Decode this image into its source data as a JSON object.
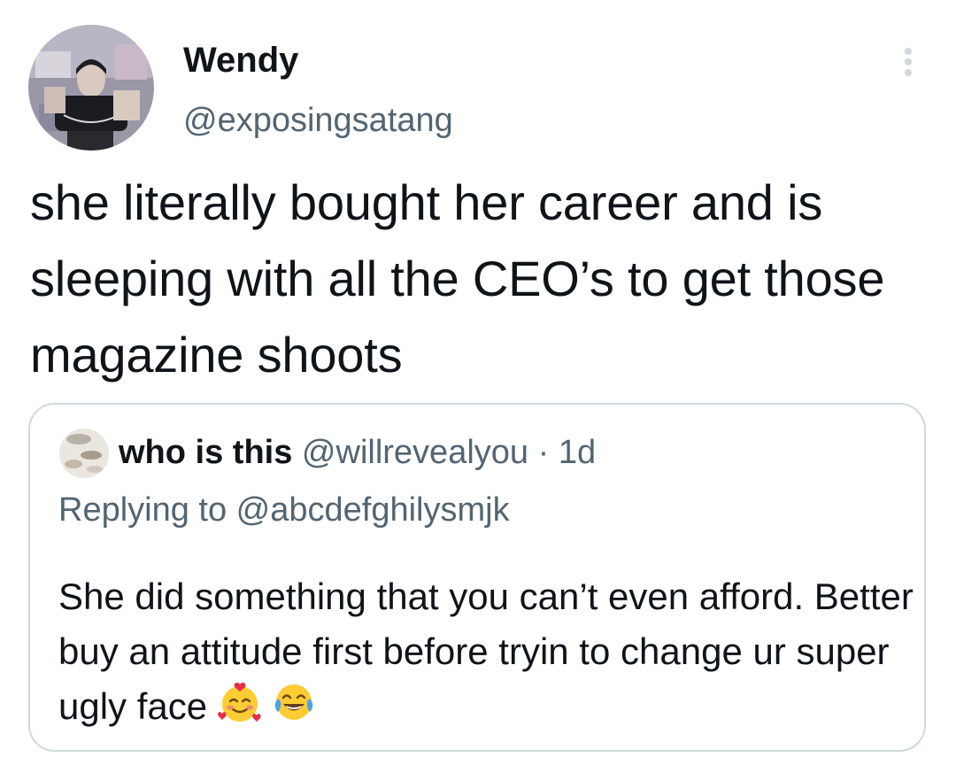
{
  "tweet": {
    "author": {
      "display_name": "Wendy",
      "handle": "@exposingsatang"
    },
    "text": "she literally bought her career and is sleeping with all the CEO’s to get those magazine shoots"
  },
  "quote": {
    "author": {
      "display_name": "who is this",
      "handle": "@willrevealyou",
      "separator": "·",
      "time": "1d"
    },
    "reply_to_label": "Replying to @abcdefghilysmjk",
    "text": "She did something that you can’t even afford. Better buy an attitude first before tryin to change ur super ugly face",
    "emojis": [
      "smiling-face-with-hearts",
      "face-with-tears-of-joy"
    ]
  },
  "icons": {
    "more": "more-icon"
  },
  "colors": {
    "primary_text": "#0f1419",
    "secondary_text": "#536471",
    "border": "#cfd9de",
    "background": "#ffffff"
  }
}
